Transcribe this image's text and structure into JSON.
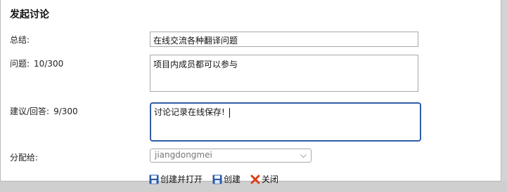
{
  "dialog": {
    "title": "发起讨论",
    "summary_label": "总结:",
    "summary_value": "在线交流各种翻译问题",
    "question_label": "问题:",
    "question_count": "10/300",
    "question_value": "项目内成员都可以参与",
    "suggestion_label": "建议/回答:",
    "suggestion_count": "9/300",
    "suggestion_value": "讨论记录在线保存!",
    "assign_label": "分配给:",
    "assign_selected": "jiangdongmei",
    "buttons": {
      "create_open": "创建并打开",
      "create": "创建",
      "close": "关闭"
    }
  },
  "icons": {
    "save": "save-icon",
    "close": "close-x-icon",
    "dropdown": "chevron-down-icon"
  },
  "colors": {
    "focus_border": "#2f5ea8",
    "close_icon": "#d9401c",
    "save_icon": "#2b5aa8"
  }
}
